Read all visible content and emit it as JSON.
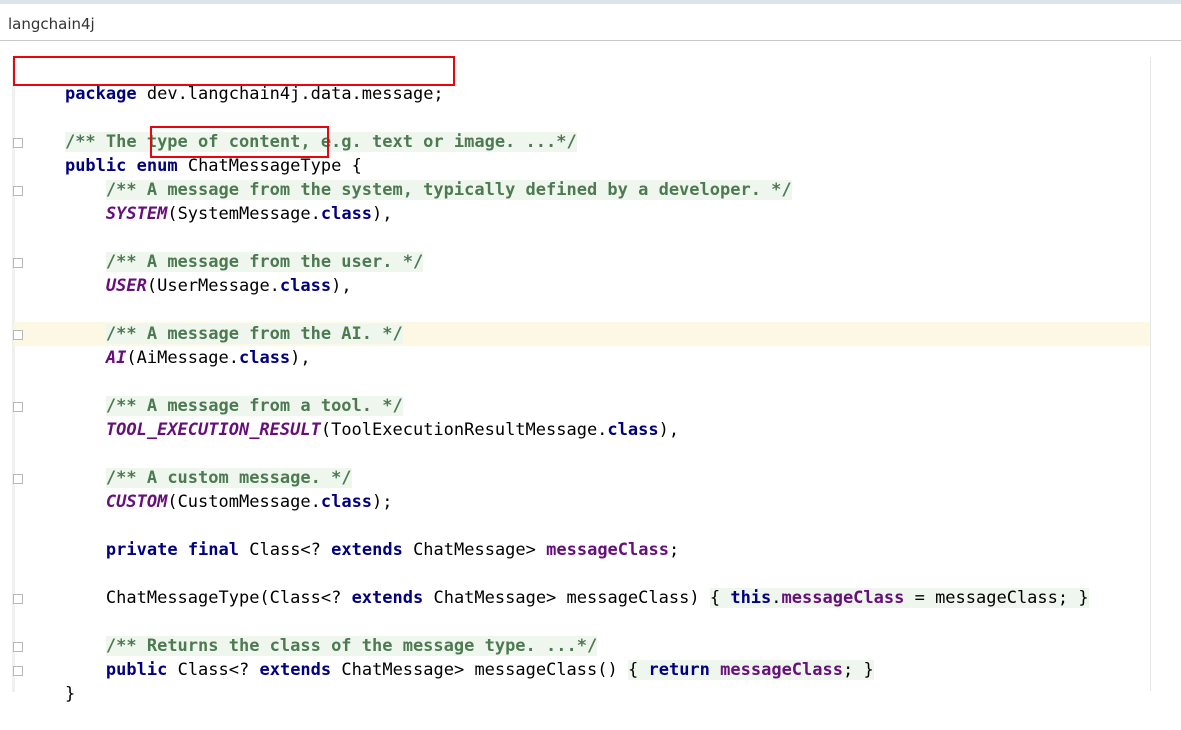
{
  "window": {
    "title": "langchain4j"
  },
  "code": {
    "package_kw": "package",
    "package_name": "dev.langchain4j.data.message;",
    "class_doc": "/** The type of content, e.g. text or image. ...*/",
    "public_kw": "public",
    "enum_kw": "enum",
    "enum_name": "ChatMessageType",
    "open_brace": "{",
    "system_doc": "/** A message from the system, typically defined by a developer. */",
    "system_const": "SYSTEM",
    "system_args_open": "(SystemMessage.",
    "class_kw": "class",
    "args_close_comma": "),",
    "user_doc": "/** A message from the user. */",
    "user_const": "USER",
    "user_args_open": "(UserMessage.",
    "ai_doc": "/** A message from the AI. */",
    "ai_const": "AI",
    "ai_args_open": "(AiMessage.",
    "tool_doc": "/** A message from a tool. */",
    "tool_const": "TOOL_EXECUTION_RESULT",
    "tool_args_open": "(ToolExecutionResultMessage.",
    "custom_doc": "/** A custom message. */",
    "custom_const": "CUSTOM",
    "custom_args_open": "(CustomMessage.",
    "args_close_semicolon": ");",
    "private_kw": "private",
    "final_kw": "final",
    "class_type": "Class<?",
    "extends_kw": "extends",
    "chat_message_gt": "ChatMessage>",
    "message_class_field": "messageClass",
    "semicolon": ";",
    "ctor_name": "ChatMessageType(Class<?",
    "ctor_param": "ChatMessage> messageClass)",
    "brace_open_sp": "{",
    "this_kw": "this",
    "dot": ".",
    "assign": " = messageClass;",
    "brace_close": "}",
    "returns_doc": "/** Returns the class of the message type. ...*/",
    "method_sig": "ChatMessage> messageClass()",
    "return_kw": "return",
    "closing_brace": "}"
  }
}
